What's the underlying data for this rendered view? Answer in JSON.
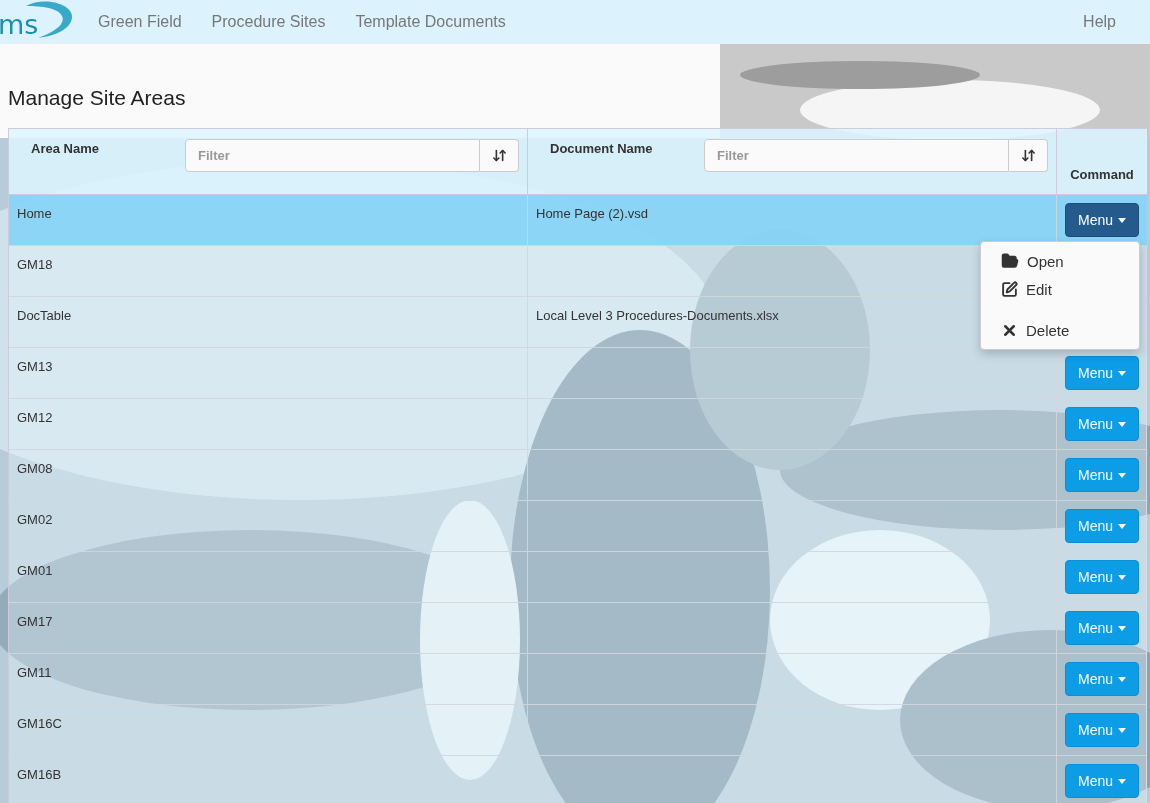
{
  "navbar": {
    "logo_text": "ms",
    "links": [
      "Green Field",
      "Procedure Sites",
      "Template Documents"
    ],
    "help": "Help"
  },
  "page_title": "Manage Site Areas",
  "table": {
    "columns": [
      {
        "label": "Area Name",
        "filter_placeholder": "Filter"
      },
      {
        "label": "Document Name",
        "filter_placeholder": "Filter"
      },
      {
        "label": "Command"
      }
    ],
    "rows": [
      {
        "area": "Home",
        "document": "Home Page (2).vsd",
        "command": "Menu",
        "selected": true
      },
      {
        "area": "GM18",
        "selected": false
      },
      {
        "area": "DocTable",
        "document": "Local Level 3 Procedures-Documents.xlsx",
        "selected": false
      },
      {
        "area": "GM13",
        "command": "Menu",
        "selected": false
      },
      {
        "area": "GM12",
        "command": "Menu",
        "selected": false
      },
      {
        "area": "GM08",
        "command": "Menu",
        "selected": false
      },
      {
        "area": "GM02",
        "command": "Menu",
        "selected": false
      },
      {
        "area": "GM01",
        "command": "Menu",
        "selected": false
      },
      {
        "area": "GM17",
        "command": "Menu",
        "selected": false
      },
      {
        "area": "GM11",
        "command": "Menu",
        "selected": false
      },
      {
        "area": "GM16C",
        "command": "Menu",
        "selected": false
      },
      {
        "area": "GM16B",
        "command": "Menu",
        "selected": false
      }
    ]
  },
  "dropdown": {
    "items": [
      {
        "kind": "open",
        "label": "Open"
      },
      {
        "kind": "edit",
        "label": "Edit"
      },
      {
        "kind": "divider"
      },
      {
        "kind": "delete",
        "label": "Delete"
      }
    ]
  }
}
